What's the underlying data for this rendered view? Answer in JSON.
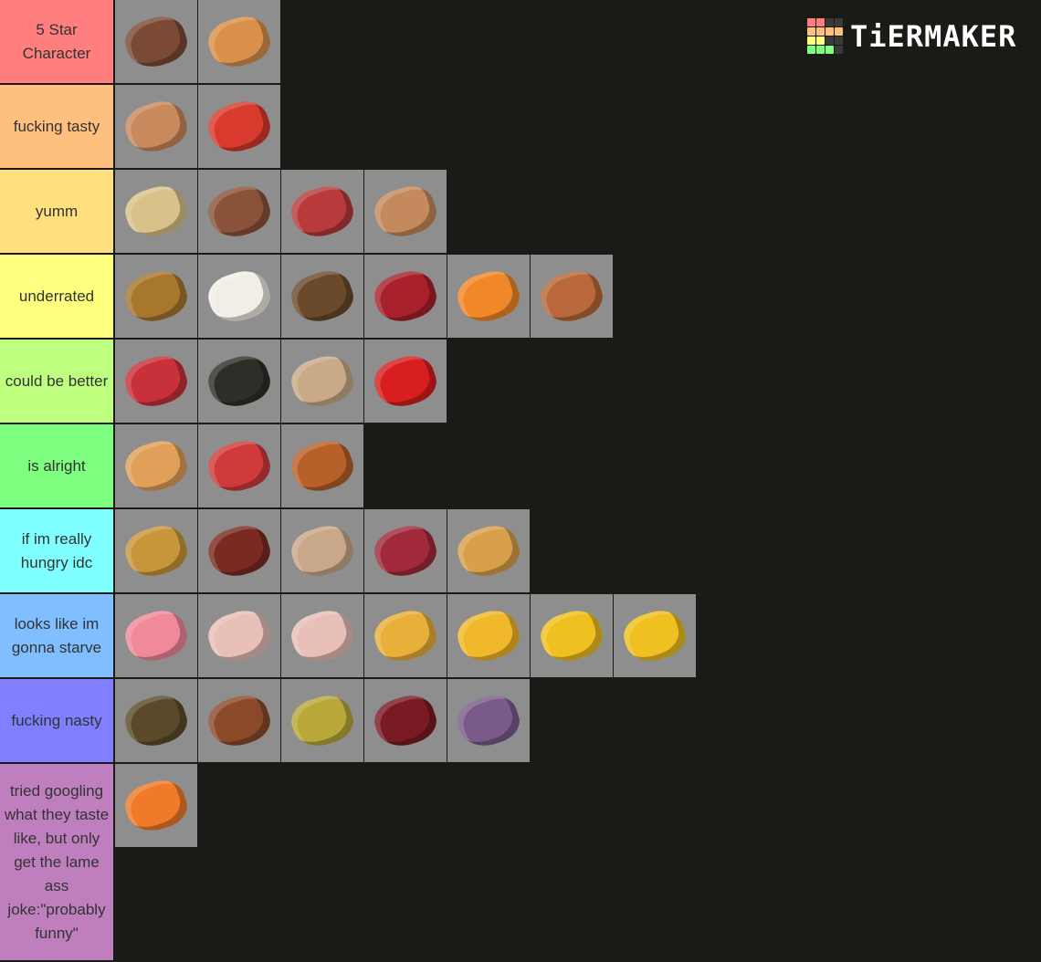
{
  "logo": {
    "text": "TiERMAKER",
    "grid_colors": [
      "#ff7f7f",
      "#ff7f7f",
      "#3a3a38",
      "#3a3a38",
      "#ffbf7f",
      "#ffbf7f",
      "#ffbf7f",
      "#ffbf7f",
      "#ffff7f",
      "#ffff7f",
      "#3a3a38",
      "#3a3a38",
      "#7fff7f",
      "#7fff7f",
      "#7fff7f",
      "#3a3a38"
    ]
  },
  "tiers": [
    {
      "label": "5 Star Character",
      "color": "#ff7f7f",
      "height": 93,
      "items": [
        {
          "icon": "steak-icon",
          "color": "#7a4a35"
        },
        {
          "icon": "cookie-icon",
          "color": "#d9904a"
        }
      ]
    },
    {
      "label": "fucking tasty",
      "color": "#ffbf7f",
      "height": 93,
      "items": [
        {
          "icon": "cooked-chicken-icon",
          "color": "#c98a5e"
        },
        {
          "icon": "melon-slice-icon",
          "color": "#d83a2e"
        }
      ]
    },
    {
      "label": "yumm",
      "color": "#ffdf7f",
      "height": 93,
      "items": [
        {
          "icon": "baked-potato-icon",
          "color": "#d8c28a"
        },
        {
          "icon": "cooked-mutton-icon",
          "color": "#8a5238"
        },
        {
          "icon": "cooked-salmon-icon",
          "color": "#b83a3a"
        },
        {
          "icon": "cooked-rabbit-icon",
          "color": "#c48a5e"
        }
      ]
    },
    {
      "label": "underrated",
      "color": "#ffff7f",
      "height": 93,
      "items": [
        {
          "icon": "bread-icon",
          "color": "#a8772e"
        },
        {
          "icon": "cake-icon",
          "color": "#f2eee6"
        },
        {
          "icon": "mushroom-stew-icon",
          "color": "#6a4a2a"
        },
        {
          "icon": "sweet-berries-icon",
          "color": "#a8202a"
        },
        {
          "icon": "carrot-icon",
          "color": "#f0882a"
        },
        {
          "icon": "cooked-cod-icon",
          "color": "#b8683a"
        }
      ]
    },
    {
      "label": "could be better",
      "color": "#bfff7f",
      "height": 93,
      "items": [
        {
          "icon": "raw-beef-icon",
          "color": "#c8303a"
        },
        {
          "icon": "dried-kelp-icon",
          "color": "#2e2e28"
        },
        {
          "icon": "raw-cod-icon",
          "color": "#c8aa88"
        },
        {
          "icon": "apple-icon",
          "color": "#d81e1e"
        }
      ]
    },
    {
      "label": "is alright",
      "color": "#7fff7f",
      "height": 93,
      "items": [
        {
          "icon": "pumpkin-pie-icon",
          "color": "#e0a05a"
        },
        {
          "icon": "raw-mutton-icon",
          "color": "#d03a3a"
        },
        {
          "icon": "rabbit-stew-icon",
          "color": "#b8602a"
        }
      ]
    },
    {
      "label": "if im really hungry idc",
      "color": "#7fffff",
      "height": 93,
      "items": [
        {
          "icon": "potato-icon",
          "color": "#c8963a"
        },
        {
          "icon": "beetroot-soup-icon",
          "color": "#7a2a22"
        },
        {
          "icon": "raw-salmon-icon",
          "color": "#c8a888"
        },
        {
          "icon": "beetroot-icon",
          "color": "#a02a3a"
        },
        {
          "icon": "raw-potato-icon",
          "color": "#d8a04a"
        }
      ]
    },
    {
      "label": "looks like im gonna starve",
      "color": "#7fbfff",
      "height": 93,
      "items": [
        {
          "icon": "raw-porkchop-icon",
          "color": "#f08a9a"
        },
        {
          "icon": "raw-rabbit-icon",
          "color": "#e8c0b8"
        },
        {
          "icon": "raw-chicken-icon",
          "color": "#e8c0b8"
        },
        {
          "icon": "pufferfish-icon",
          "color": "#e8b03a"
        },
        {
          "icon": "golden-carrot-icon",
          "color": "#f0b82a"
        },
        {
          "icon": "golden-apple-icon",
          "color": "#f0c020"
        },
        {
          "icon": "enchanted-golden-apple-icon",
          "color": "#f0c020"
        }
      ]
    },
    {
      "label": "fucking nasty",
      "color": "#7f7fff",
      "height": 93,
      "items": [
        {
          "icon": "suspicious-stew-icon",
          "color": "#5a4a2a"
        },
        {
          "icon": "rotten-flesh-icon",
          "color": "#8a4a2a"
        },
        {
          "icon": "poisonous-potato-icon",
          "color": "#b8a83a"
        },
        {
          "icon": "spider-eye-icon",
          "color": "#7a1a22"
        },
        {
          "icon": "chorus-fruit-icon",
          "color": "#7a5a8a"
        }
      ]
    },
    {
      "label": "tried googling what they taste like, but only get the lame ass joke:\"probably funny\"",
      "color": "#bf7fbf",
      "height": 217,
      "items": [
        {
          "icon": "tropical-fish-icon",
          "color": "#f07a2a"
        }
      ]
    }
  ]
}
